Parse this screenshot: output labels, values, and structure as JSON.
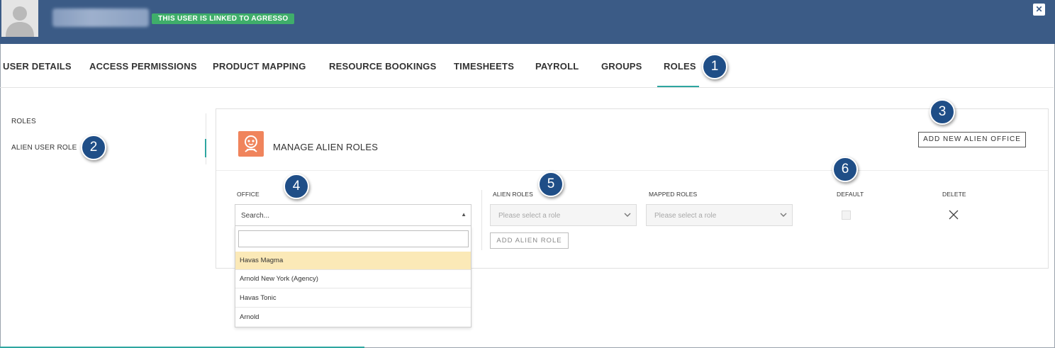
{
  "header": {
    "linked_badge": "THIS USER IS LINKED TO AGRESSO",
    "close_label": "✕"
  },
  "tabs": [
    {
      "label": "USER DETAILS"
    },
    {
      "label": "ACCESS PERMISSIONS"
    },
    {
      "label": "PRODUCT MAPPING"
    },
    {
      "label": "RESOURCE BOOKINGS"
    },
    {
      "label": "TIMESHEETS"
    },
    {
      "label": "PAYROLL"
    },
    {
      "label": "GROUPS"
    },
    {
      "label": "ROLES",
      "active": true
    }
  ],
  "sidebar": {
    "items": [
      {
        "label": "ROLES"
      },
      {
        "label": "ALIEN USER ROLE",
        "active": true
      }
    ]
  },
  "callouts": [
    "1",
    "2",
    "3",
    "4",
    "5",
    "6"
  ],
  "panel": {
    "title": "MANAGE ALIEN ROLES",
    "add_office_button": "ADD NEW ALIEN OFFICE",
    "columns": {
      "office": "OFFICE",
      "alien_roles": "ALIEN ROLES",
      "mapped_roles": "MAPPED ROLES",
      "default": "DEFAULT",
      "delete": "DELETE"
    },
    "office_select": {
      "value": "Search...",
      "search_value": "",
      "options": [
        "Havas Magma",
        "Arnold New York (Agency)",
        "Havas Tonic",
        "Arnold"
      ],
      "highlighted": "Havas Magma"
    },
    "alien_role_placeholder": "Please select a role",
    "mapped_role_placeholder": "Please select a role",
    "add_alien_role_button": "ADD ALIEN ROLE",
    "default_checked": false
  },
  "colors": {
    "header_bg": "#3b5b86",
    "badge_green": "#3fae6a",
    "accent_teal": "#2ea6a0",
    "callout_blue": "#1f4e87",
    "alien_icon_orange": "#f0845c",
    "highlight_option": "#fbe9b7"
  }
}
